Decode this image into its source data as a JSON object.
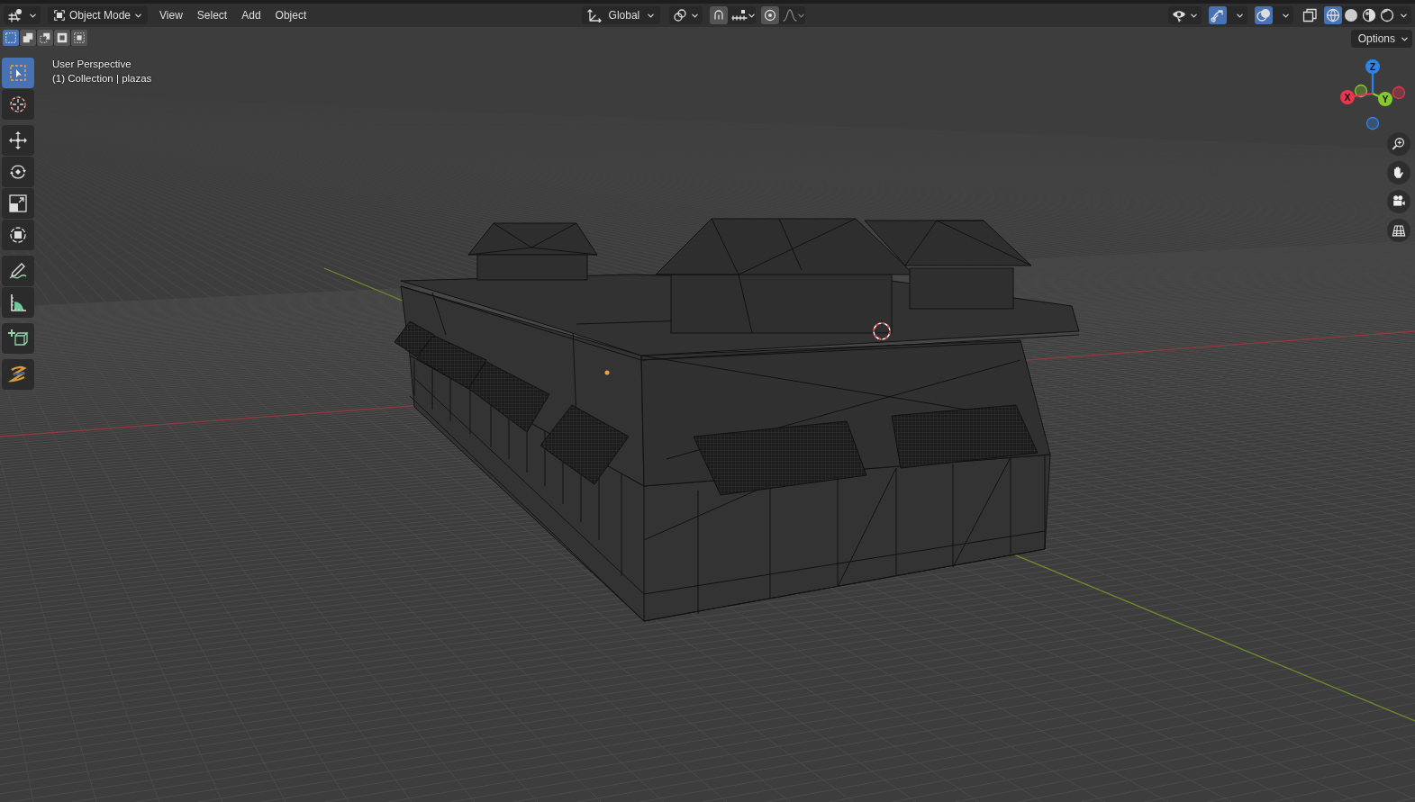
{
  "header": {
    "mode": {
      "label": "Object Mode"
    },
    "menus": [
      "View",
      "Select",
      "Add",
      "Object"
    ],
    "transform_orientation": {
      "label": "Global"
    },
    "toggles": {
      "snap": {
        "on": true
      },
      "proportional_editing": {
        "on": true
      },
      "gizmos": {
        "on": true
      },
      "overlays": {
        "on": true
      },
      "xray": {
        "on": false
      }
    },
    "shading": [
      {
        "kind": "wireframe",
        "selected": true
      },
      {
        "kind": "solid",
        "selected": false
      },
      {
        "kind": "material",
        "selected": false
      },
      {
        "kind": "rendered",
        "selected": false
      }
    ]
  },
  "select_modes": [
    {
      "kind": "set",
      "selected": true
    },
    {
      "kind": "extend",
      "selected": false
    },
    {
      "kind": "subtract",
      "selected": false
    },
    {
      "kind": "invert",
      "selected": false
    },
    {
      "kind": "intersect",
      "selected": false
    }
  ],
  "options_button": {
    "label": "Options"
  },
  "toolbar": {
    "tools": [
      {
        "kind": "select_box",
        "selected": true
      },
      {
        "kind": "cursor",
        "selected": false
      },
      {
        "kind": "move",
        "selected": false
      },
      {
        "kind": "rotate",
        "selected": false
      },
      {
        "kind": "scale",
        "selected": false
      },
      {
        "kind": "transform",
        "selected": false
      },
      {
        "kind": "annotate",
        "selected": false
      },
      {
        "kind": "measure",
        "selected": false
      },
      {
        "kind": "add_cube",
        "selected": false
      },
      {
        "kind": "shear",
        "selected": false
      }
    ]
  },
  "viewport": {
    "overlay_text": [
      "User Perspective",
      "(1) Collection | plazas"
    ],
    "gizmo": {
      "axes": [
        {
          "label": "X",
          "color": "#e8364e"
        },
        {
          "label": "Y",
          "color": "#86c92e"
        },
        {
          "label": "Z",
          "color": "#2f84e3"
        }
      ]
    }
  }
}
